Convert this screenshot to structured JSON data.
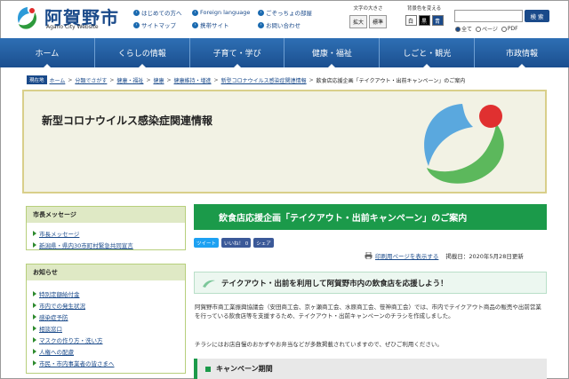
{
  "header": {
    "site_title": "阿賀野市",
    "site_subtitle": "Agano City Website",
    "links": [
      {
        "label": "はじめての方へ"
      },
      {
        "label": "Foreign language"
      },
      {
        "label": "ごぞっちょの部屋"
      },
      {
        "label": "サイトマップ"
      },
      {
        "label": "携帯サイト"
      },
      {
        "label": "お問い合わせ"
      }
    ],
    "font_size": {
      "label": "文字の大きさ",
      "enlarge": "拡大",
      "standard": "標準"
    },
    "bg_color": {
      "label": "背景色を変える",
      "white": "白",
      "black": "黒",
      "blue": "青"
    },
    "search": {
      "placeholder": "",
      "button": "検 索",
      "options": [
        "全て",
        "ページ",
        "PDF"
      ],
      "selected": "全て"
    },
    "colors": {
      "brand_blue": "#1a4a8a",
      "accent_green": "#1b9a4a"
    }
  },
  "nav": {
    "items": [
      {
        "label": "ホーム"
      },
      {
        "label": "くらしの情報"
      },
      {
        "label": "子育て・学び"
      },
      {
        "label": "健康・福祉"
      },
      {
        "label": "しごと・観光"
      },
      {
        "label": "市政情報"
      }
    ]
  },
  "breadcrumb": {
    "here_label": "現在地",
    "items": [
      {
        "label": "ホーム"
      },
      {
        "label": "分類でさがす"
      },
      {
        "label": "健康・福祉"
      },
      {
        "label": "健康"
      },
      {
        "label": "健康維持・増進"
      },
      {
        "label": "新型コロナウイルス感染症関連情報"
      }
    ],
    "current": "飲食店応援企画「テイクアウト・出前キャンペーン」のご案内"
  },
  "banner": {
    "title": "新型コロナウイルス感染症関連情報"
  },
  "sidebar": {
    "mayor": {
      "heading": "市長メッセージ",
      "items": [
        {
          "label": "市長メッセージ"
        },
        {
          "label": "新潟県・県内30市町村緊急共同宣言"
        }
      ]
    },
    "notice": {
      "heading": "お知らせ",
      "items": [
        {
          "label": "特別定額給付金"
        },
        {
          "label": "市内での発生状況"
        },
        {
          "label": "感染症予防"
        },
        {
          "label": "相談窓口"
        },
        {
          "label": "マスクの作り方・洗い方"
        },
        {
          "label": "人権への配慮"
        },
        {
          "label": "市民・市内事業者の皆さまへ"
        }
      ]
    }
  },
  "main": {
    "title": "飲食店応援企画「テイクアウト・出前キャンペーン」のご案内",
    "sns": {
      "tweet": "ツイート",
      "like": "いいね！ 0",
      "share": "シェア"
    },
    "print_label": "印刷用ページを表示する",
    "published": "掲載日：2020年5月28日更新",
    "subtitle": "テイクアウト・出前を利用して阿賀野市内の飲食店を応援しよう！",
    "paragraph1": "阿賀野市商工業振興協議会（安田商工会、京ヶ瀬商工会、水原商工会、笹神商工会）では、市内でテイクアウト商品の販売や出前営業を行っている飲食店等を支援するため、テイクアウト・出前キャンペーンのチラシを作成しました。",
    "paragraph2": "チラシにはお店自慢のおかずやお弁当などが多数掲載されていますので、ぜひご利用ください。",
    "section_title": "キャンペーン期間"
  }
}
